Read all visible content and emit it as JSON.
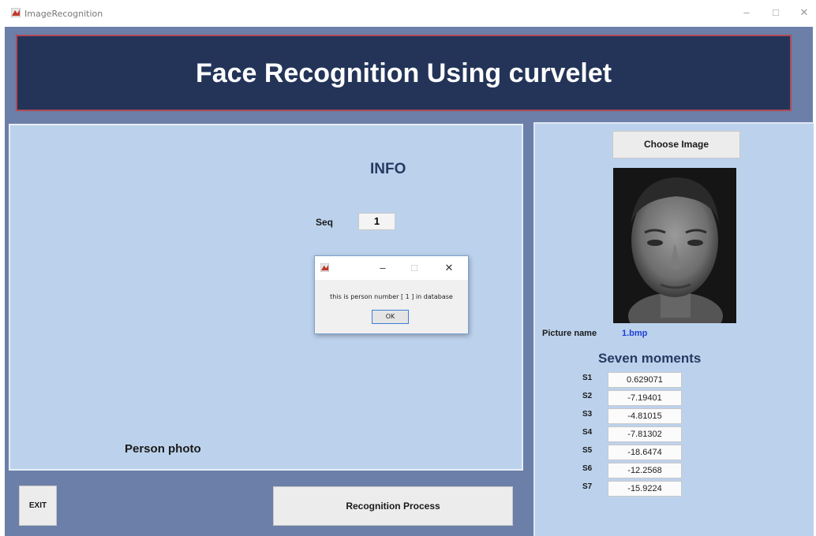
{
  "window": {
    "title": "ImageRecognition",
    "minimize": "–",
    "maximize": "□",
    "close": "✕"
  },
  "header": {
    "title": "Face Recognition Using curvelet"
  },
  "info": {
    "title": "INFO",
    "seq_label": "Seq",
    "seq_value": "1",
    "person_photo_label": "Person photo"
  },
  "dialog": {
    "message": "this is person number [ 1 ] in database",
    "ok": "OK",
    "minimize": "–",
    "maximize": "□",
    "close": "✕"
  },
  "buttons": {
    "exit": "EXIT",
    "recognition": "Recognition Process",
    "choose_image": "Choose Image"
  },
  "picture": {
    "name_label": "Picture name",
    "name_value": "1.bmp"
  },
  "moments": {
    "title": "Seven moments",
    "items": [
      {
        "label": "S1",
        "value": "0.629071"
      },
      {
        "label": "S2",
        "value": "-7.19401"
      },
      {
        "label": "S3",
        "value": "-4.81015"
      },
      {
        "label": "S4",
        "value": "-7.81302"
      },
      {
        "label": "S5",
        "value": "-18.6474"
      },
      {
        "label": "S6",
        "value": "-12.2568"
      },
      {
        "label": "S7",
        "value": "-15.9224"
      }
    ]
  }
}
